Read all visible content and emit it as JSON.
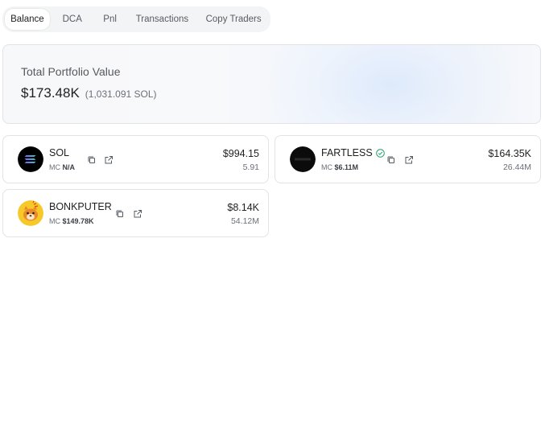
{
  "tabs": [
    {
      "label": "Balance",
      "active": true
    },
    {
      "label": "DCA",
      "active": false
    },
    {
      "label": "Pnl",
      "active": false
    },
    {
      "label": "Transactions",
      "active": false
    },
    {
      "label": "Copy Traders",
      "active": false
    }
  ],
  "portfolio": {
    "label": "Total Portfolio Value",
    "usd_value": "$173.48K",
    "sol_value": "(1,031.091 SOL)"
  },
  "tokens": [
    {
      "name": "SOL",
      "mc_label": "MC",
      "mc_value": "N/A",
      "usd_value": "$994.15",
      "amount": "5.91",
      "verified": false,
      "logo_icon": "solana-logo-icon"
    },
    {
      "name": "FARTLESS",
      "mc_label": "MC",
      "mc_value": "$6.11M",
      "usd_value": "$164.35K",
      "amount": "26.44M",
      "verified": true,
      "logo_icon": "fartless-logo-icon"
    },
    {
      "name": "BONKPUTER",
      "mc_label": "MC",
      "mc_value": "$149.78K",
      "usd_value": "$8.14K",
      "amount": "54.12M",
      "verified": false,
      "logo_icon": "bonkputer-logo-icon"
    }
  ],
  "icons": {
    "copy": "copy-icon",
    "external_link": "external-link-icon",
    "verified": "verified-check-icon"
  },
  "colors": {
    "verified": "#22a06b",
    "tab_bar_bg": "#f3f4f6",
    "border": "#e1e3e6"
  }
}
